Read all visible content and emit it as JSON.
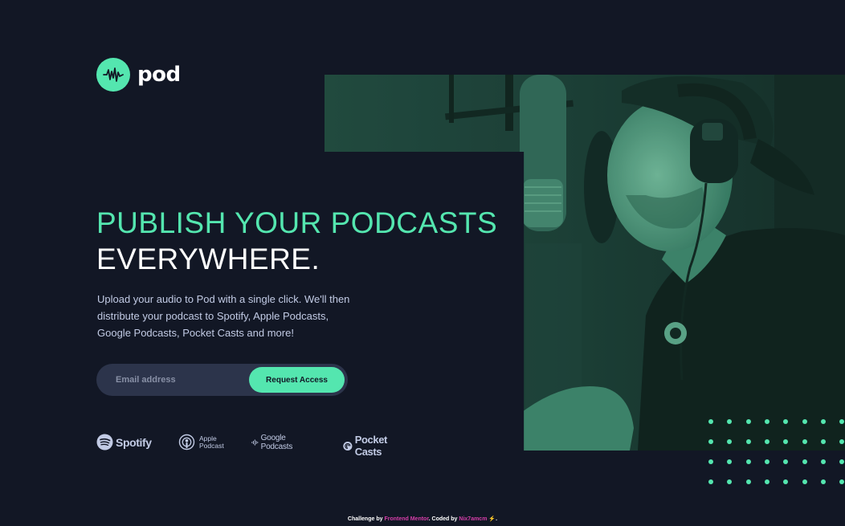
{
  "brand": {
    "name": "pod"
  },
  "hero": {
    "title_line1": "PUBLISH YOUR PODCASTS",
    "title_line2": "EVERYWHERE.",
    "description": "Upload your audio to Pod with a single click. We'll then distribute your podcast to Spotify, Apple Podcasts, Google Podcasts, Pocket Casts and more!"
  },
  "signup": {
    "email_placeholder": "Email address",
    "button_label": "Request Access"
  },
  "platforms": [
    {
      "name": "Spotify",
      "icon": "spotify-icon"
    },
    {
      "line1": "Apple",
      "line2": "Podcast",
      "icon": "apple-podcast-icon"
    },
    {
      "name": "Google Podcasts",
      "icon": "google-podcasts-icon"
    },
    {
      "name": "Pocket Casts",
      "icon": "pocket-casts-icon"
    }
  ],
  "footer": {
    "prefix": "Challenge by",
    "link1": "Frontend Mentor",
    "middle": ". Coded by",
    "link2": "Nix7amcm",
    "bolt": "⚡",
    "suffix": "."
  },
  "colors": {
    "background": "#121725",
    "accent": "#54e6af",
    "text": "#c2cbe5",
    "input_bg": "#2c344b",
    "photo_tint": "#1f4b3f"
  }
}
